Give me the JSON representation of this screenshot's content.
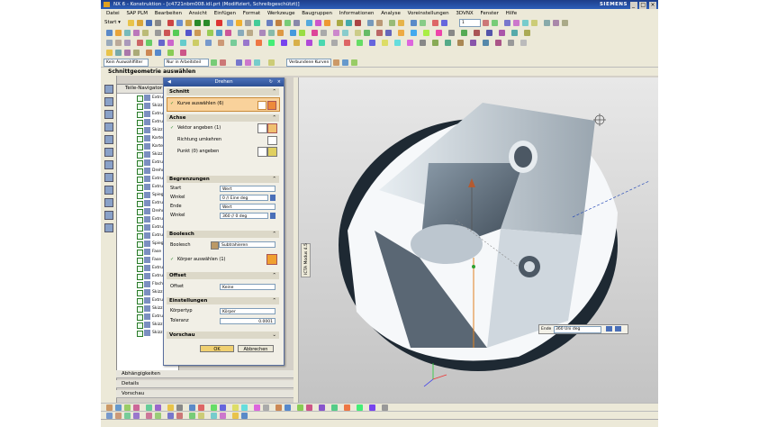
{
  "window": {
    "title": "NX 6 - Konstruktion - [c4721nbm008.idl.prt (Modifiziert, Schreibgeschützt)]",
    "brand": "SIEMENS",
    "buttons": [
      "_",
      "□",
      "×"
    ]
  },
  "menu": [
    "Datei",
    "SAP PLM",
    "Bearbeiten",
    "Ansicht",
    "Einfügen",
    "Format",
    "Werkzeuge",
    "Baugruppen",
    "Informationen",
    "Analyse",
    "Voreinstellungen",
    "3DVNX",
    "Fenster",
    "Hilfe"
  ],
  "toolbar": {
    "start": "Start ▾",
    "filter1": "Kein Auswahlfilter",
    "filter2": "Nur in Arbeitsteil",
    "filter3": "Verbundene Kurven",
    "spinner": "1"
  },
  "dialog_header": "Schnittgeometrie auswählen",
  "navigator": {
    "title": "Teile-Navigator",
    "items": [
      "Extru",
      "Skizz",
      "Extru",
      "Extru",
      "Skizz",
      "Karte",
      "Karte",
      "Skizz",
      "Extru",
      "Drehu",
      "Extru",
      "Extru",
      "Spieg",
      "Extru",
      "Drehu",
      "Extru",
      "Extru",
      "Extru",
      "Spieg",
      "Fase",
      "Fase",
      "Extru",
      "Extru",
      "Flach",
      "Skizz",
      "Extru",
      "Skizz",
      "Extru",
      "Skizz",
      "Skizz"
    ]
  },
  "bottom_sections": [
    "Abhängigkeiten",
    "Details",
    "Vorschau"
  ],
  "dialog": {
    "title": "Drehen",
    "schnitt": {
      "label": "Schnitt",
      "select": "Kurve auswählen (6)"
    },
    "achse": {
      "label": "Achse",
      "vector": "Vektor angeben (1)",
      "reverse": "Richtung umkehren",
      "point": "Punkt (0) angeben"
    },
    "begrenzungen": {
      "label": "Begrenzungen",
      "start_label": "Start",
      "start_value": "Wert",
      "angle1_label": "Winkel",
      "angle1_value": "0 // Eine deg",
      "end_label": "Ende",
      "end_value": "Wert",
      "angle2_label": "Winkel",
      "angle2_value": "360 // 0 deg"
    },
    "boolesch": {
      "label": "Boolesch",
      "field_label": "Boolesch",
      "value": "Subtrahieren",
      "body": "Körper auswählen (1)"
    },
    "offset": {
      "label": "Offset",
      "field_label": "Offset",
      "value": "Keine"
    },
    "einstellungen": {
      "label": "Einstellungen",
      "koerpertyp_label": "Körpertyp",
      "koerpertyp_value": "Körper",
      "toleranz_label": "Toleranz",
      "toleranz_value": "0.0001"
    },
    "vorschau": "Vorschau",
    "ok": "OK",
    "cancel": "Abbrechen"
  },
  "viewport": {
    "side_tab": "ICTA Modus 4.5",
    "end_field_label": "Ende",
    "end_field_value": "360",
    "end_field_unit": "Uni deg"
  }
}
